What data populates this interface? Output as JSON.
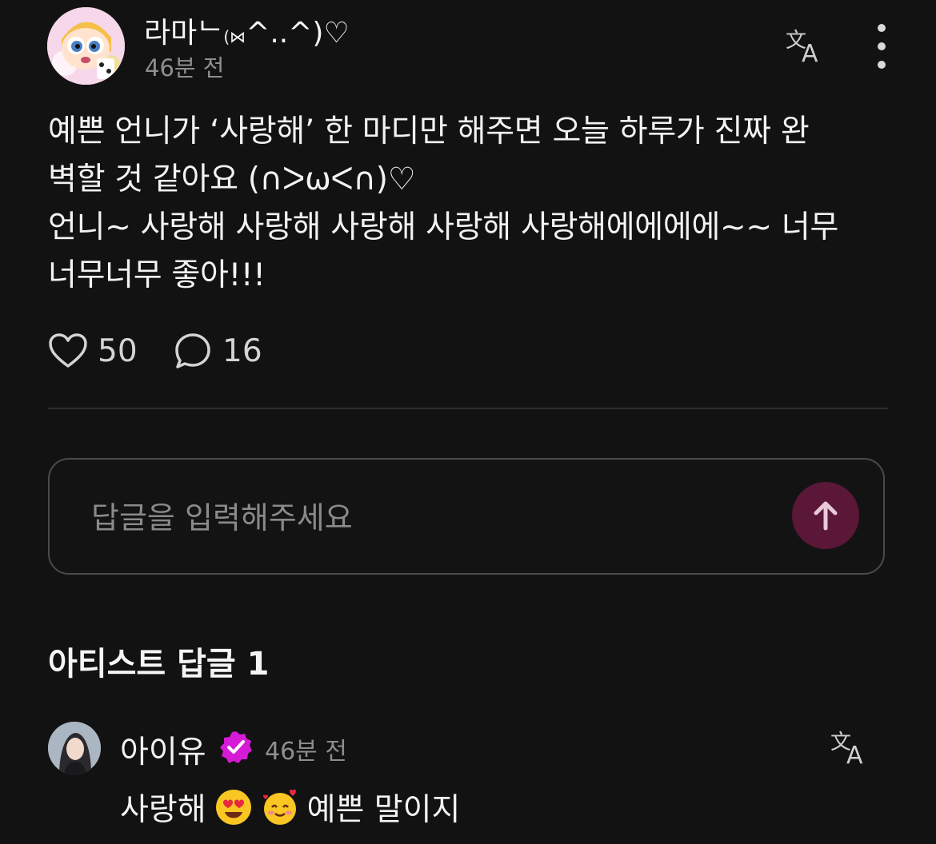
{
  "post": {
    "author": {
      "name": "라마ᄂ",
      "name_small": "(⋈",
      "name_tail": "^..^)♡"
    },
    "time": "46분 전",
    "body": "예쁜 언니가 ‘사랑해’ 한 마디만 해주면 오늘 하루가 진짜 완\n벽할 것 같아요 (∩ᐳωᐸ∩)♡\n언니~ 사랑해 사랑해 사랑해 사랑해 사랑해에에에에~~ 너무\n너무너무 좋아!!!",
    "likes": "50",
    "comments": "16",
    "icons": {
      "translate": "translate-icon",
      "more": "more-vertical-icon",
      "like": "heart-icon",
      "comment": "speech-bubble-icon"
    }
  },
  "reply_input": {
    "placeholder": "답글을 입력해주세요",
    "value": "",
    "send_icon": "arrow-up-icon"
  },
  "artist_replies": {
    "title": "아티스트 답글 1",
    "items": [
      {
        "name": "아이유",
        "time": "46분 전",
        "text_before": "사랑해",
        "text_after": "예쁜 말이지",
        "emojis": [
          "heart-eyes-emoji",
          "smiling-face-with-hearts-emoji"
        ]
      }
    ]
  },
  "colors": {
    "background": "#121212",
    "text": "#f2f2f2",
    "muted": "#8e8e8e",
    "send_button": "#5a1737",
    "verified_badge": "#d61bd6"
  }
}
